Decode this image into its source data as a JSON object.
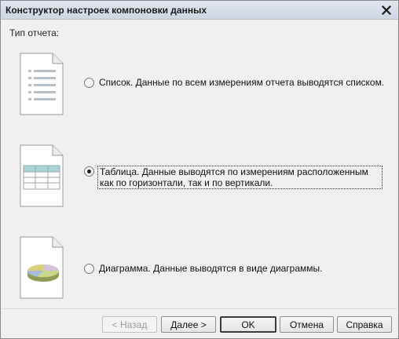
{
  "window": {
    "title": "Конструктор настроек компоновки данных",
    "close_icon": "close-icon"
  },
  "report_type_label": "Тип отчета:",
  "options": [
    {
      "icon": "list-document-icon",
      "label": "Список. Данные по всем измерениям отчета выводятся списком.",
      "checked": false
    },
    {
      "icon": "table-document-icon",
      "label": "Таблица. Данные выводятся по измерениям расположенным как по горизонтали, так и по вертикали.",
      "checked": true
    },
    {
      "icon": "chart-document-icon",
      "label": "Диаграмма. Данные выводятся в виде диаграммы.",
      "checked": false
    }
  ],
  "buttons": {
    "back": "< Назад",
    "next": "Далее >",
    "ok": "OK",
    "cancel": "Отмена",
    "help": "Справка"
  }
}
